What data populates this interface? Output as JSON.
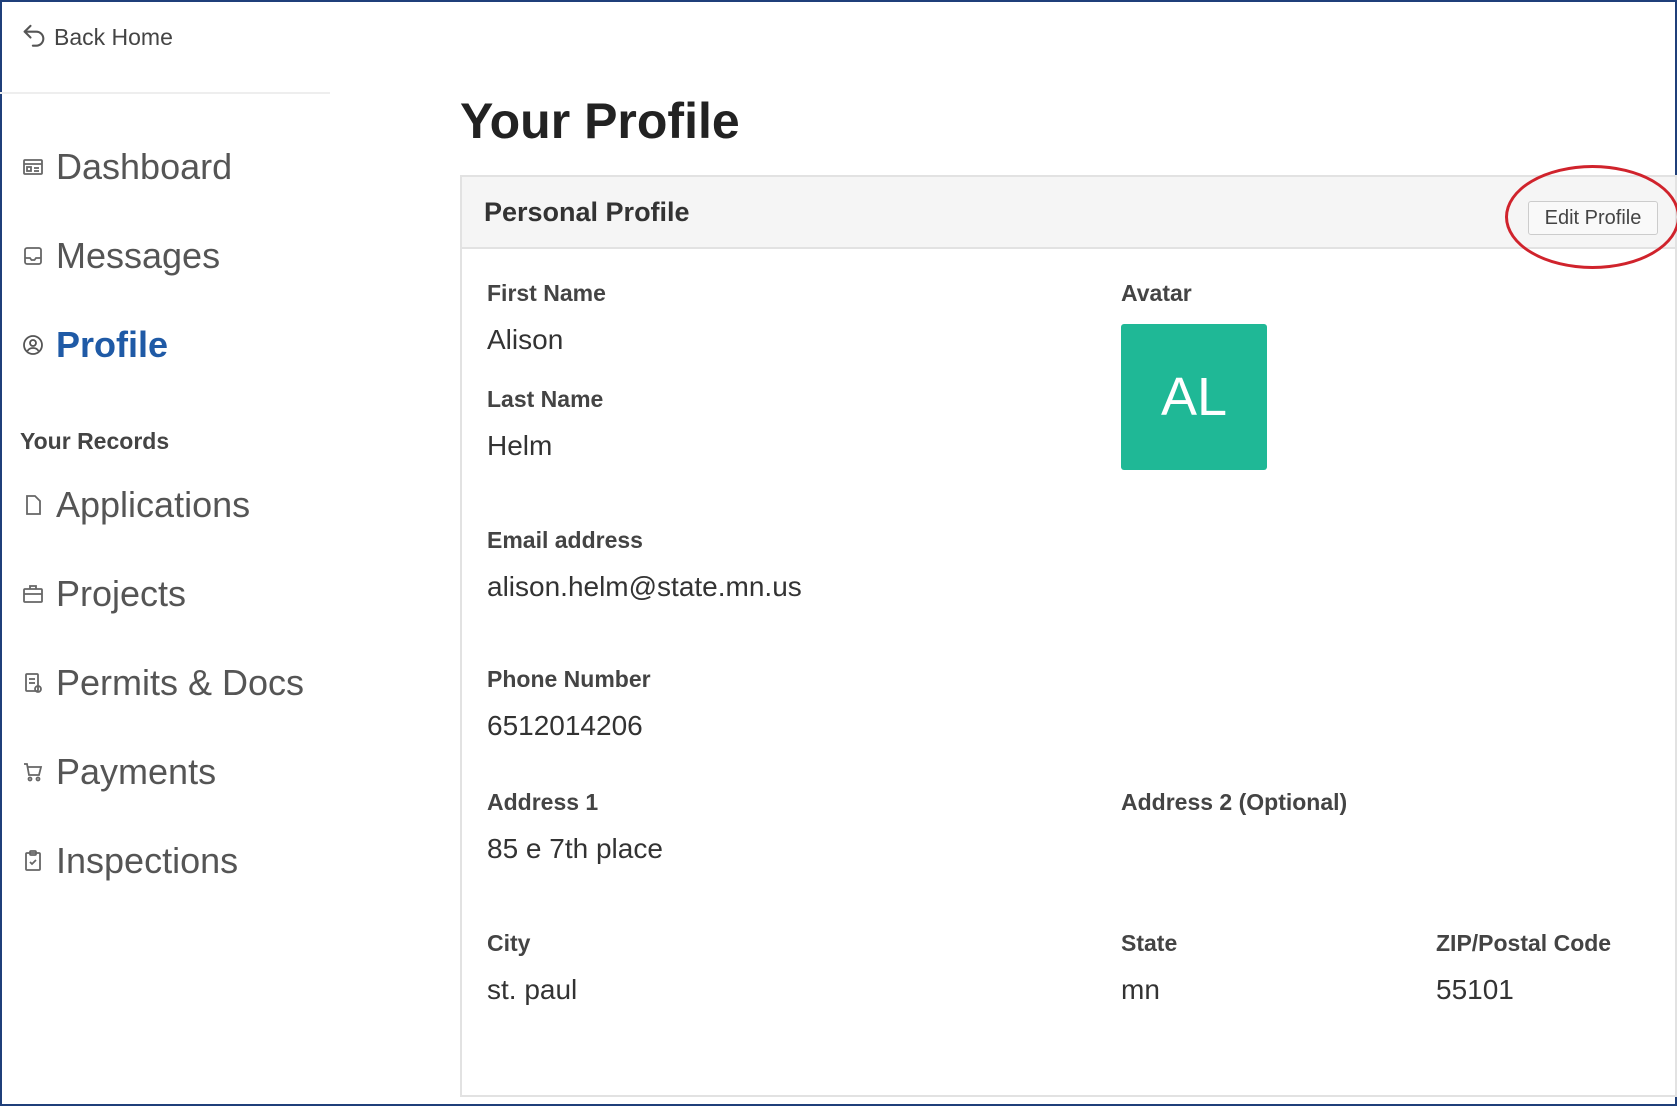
{
  "nav": {
    "back_home": "Back Home",
    "items": [
      {
        "label": "Dashboard",
        "icon": "dashboard-icon"
      },
      {
        "label": "Messages",
        "icon": "inbox-icon"
      },
      {
        "label": "Profile",
        "icon": "user-circle-icon",
        "active": true
      }
    ],
    "records_heading": "Your Records",
    "records": [
      {
        "label": "Applications",
        "icon": "file-icon"
      },
      {
        "label": "Projects",
        "icon": "briefcase-icon"
      },
      {
        "label": "Permits & Docs",
        "icon": "document-icon"
      },
      {
        "label": "Payments",
        "icon": "cart-icon"
      },
      {
        "label": "Inspections",
        "icon": "clipboard-icon"
      }
    ]
  },
  "page": {
    "title": "Your Profile"
  },
  "panel": {
    "title": "Personal Profile",
    "edit_button": "Edit Profile",
    "fields": {
      "first_name_label": "First Name",
      "first_name": "Alison",
      "last_name_label": "Last Name",
      "last_name": "Helm",
      "avatar_label": "Avatar",
      "avatar_initials": "AL",
      "email_label": "Email address",
      "email": "alison.helm@state.mn.us",
      "phone_label": "Phone Number",
      "phone": "6512014206",
      "address1_label": "Address 1",
      "address1": "85 e 7th place",
      "address2_label": "Address 2 (Optional)",
      "city_label": "City",
      "city": "st. paul",
      "state_label": "State",
      "state": "mn",
      "zip_label": "ZIP/Postal Code",
      "zip": "55101"
    }
  },
  "colors": {
    "active_nav": "#1f5aa6",
    "avatar_bg": "#1fb896",
    "highlight_ring": "#d0232c",
    "frame_border": "#1f3f7a"
  }
}
